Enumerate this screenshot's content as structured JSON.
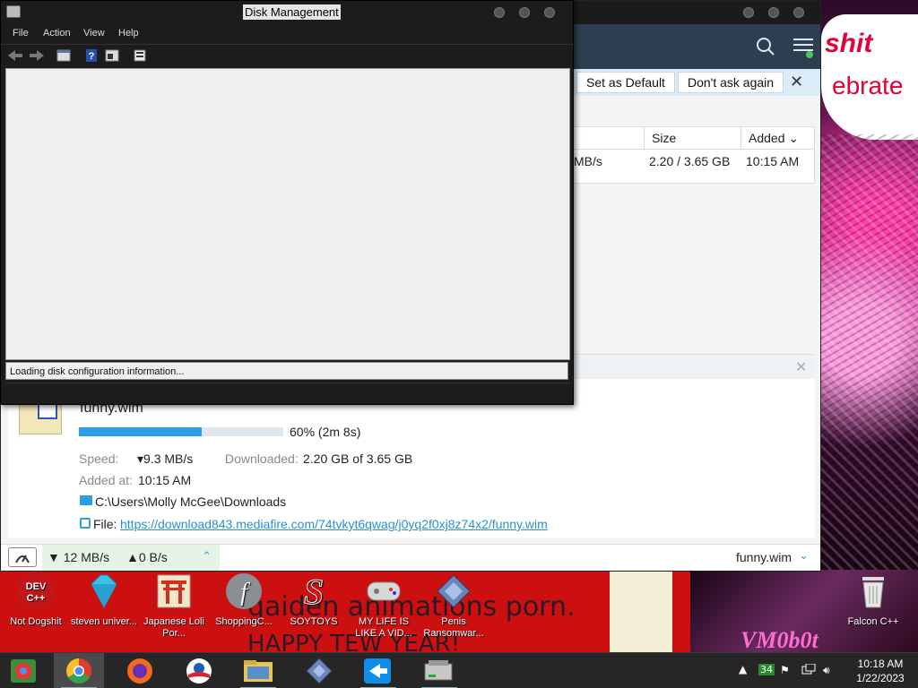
{
  "disk_management": {
    "title": "Disk Management",
    "menu": [
      "File",
      "Action",
      "View",
      "Help"
    ],
    "status": "Loading disk configuration information..."
  },
  "browser": {
    "notification": {
      "set_default_label": "Set as Default",
      "dont_ask_label": "Don't ask again",
      "close": "✕"
    },
    "table": {
      "headers": {
        "size": "Size",
        "added": "Added ⌄"
      },
      "row": {
        "speed": "MB/s",
        "size": "2.20 / 3.65 GB",
        "added": "10:15 AM"
      }
    },
    "download": {
      "name": "funny.wim",
      "progress_percent": 60,
      "progress_text": "60% (2m 8s)",
      "speed_label": "Speed:",
      "speed_value": "▾9.3 MB/s",
      "downloaded_label": "Downloaded:",
      "downloaded_value": "2.20 GB of 3.65 GB",
      "added_label": "Added at:",
      "added_value": "10:15 AM",
      "path": "C:\\Users\\Molly McGee\\Downloads",
      "file_label": "File:",
      "file_url": "https://download843.mediafire.com/74tvkyt6qwag/j0yq2f0xj8z74x2/funny.wim"
    },
    "bottombar": {
      "down_speed": "▼ 12 MB/s",
      "up_speed": "▲0 B/s",
      "current_file": "funny.wim"
    }
  },
  "desktop_icons": [
    {
      "label": "Not Dogshit",
      "icon": "dev-cpp-icon"
    },
    {
      "label": "steven univer...",
      "icon": "diamond-icon"
    },
    {
      "label": "Japanese Loli Por...",
      "icon": "torii-icon"
    },
    {
      "label": "ShoppingC...",
      "icon": "flash-icon"
    },
    {
      "label": "SOYTOYS",
      "icon": "s-logo-icon"
    },
    {
      "label": "MY LIFE IS LIKE A VID...",
      "icon": "gamepad-icon"
    },
    {
      "label": "Penis Ransomwar...",
      "icon": "setup-icon"
    },
    {
      "label": "Falcon C++",
      "icon": "recycle-bin-icon"
    }
  ],
  "wallpaper": {
    "text1": "shit",
    "text2": "ebrate",
    "caption1": "gaiden animations porn.",
    "caption2": "HAPPY TEW YEAR!",
    "signature": "VM0b0t"
  },
  "taskbar": {
    "apps": [
      "chrome-remote-icon",
      "chrome-icon",
      "firefox-icon",
      "obama-logo-icon",
      "file-explorer-icon",
      "setup-icon",
      "teamviewer-icon",
      "disk-management-icon"
    ],
    "tray_badge": "34",
    "time": "10:18 AM",
    "date": "1/22/2023"
  },
  "colors": {
    "accent": "#2a9ee8",
    "header": "#2c3e50",
    "notif": "#d9ecf7"
  }
}
